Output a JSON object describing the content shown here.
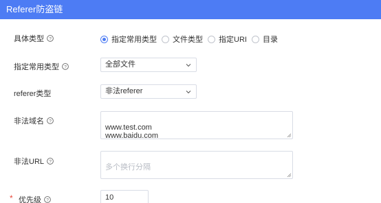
{
  "theme": {
    "accent": "#4d7cf4",
    "required": "#e84a3c"
  },
  "header": {
    "title": "Referer防盗链"
  },
  "form": {
    "type_label": "具体类型",
    "type_options": [
      "指定常用类型",
      "文件类型",
      "指定URI",
      "目录"
    ],
    "type_selected_index": 0,
    "common_type_label": "指定常用类型",
    "common_type_value": "全部文件",
    "referer_type_label": "referer类型",
    "referer_type_value": "非法referer",
    "illegal_domain_label": "非法域名",
    "illegal_domain_value": "www.test.com\nwww.baidu.com",
    "illegal_url_label": "非法URL",
    "illegal_url_placeholder": "多个换行分隔",
    "priority_label": "优先级",
    "priority_required_mark": "*",
    "priority_value": "10"
  },
  "icons": {
    "help": "question-circle-icon",
    "dropdown": "chevron-down-icon"
  }
}
